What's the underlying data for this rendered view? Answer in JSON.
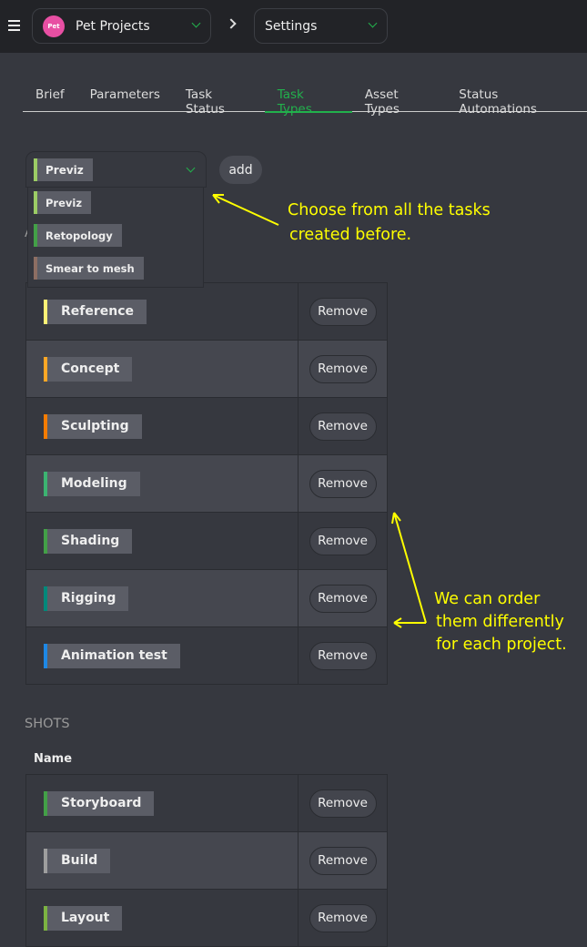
{
  "topbar": {
    "project": "Pet Projects",
    "section": "Settings",
    "logo_text": "Pet Projects"
  },
  "tabs": [
    {
      "label": "Brief"
    },
    {
      "label": "Parameters"
    },
    {
      "label": "Task Status"
    },
    {
      "label": "Task Types",
      "active": true
    },
    {
      "label": "Asset Types"
    },
    {
      "label": "Status Automations"
    }
  ],
  "selector": {
    "selected": {
      "label": "Previz",
      "color": "#9ccc65"
    },
    "add_label": "add",
    "options": [
      {
        "label": "Previz",
        "color": "#9ccc65"
      },
      {
        "label": "Retopology",
        "color": "#43a047"
      },
      {
        "label": "Smear to mesh",
        "color": "#8d6e63"
      }
    ]
  },
  "assets": {
    "heading": "A",
    "rows": [
      {
        "label": "Reference",
        "color": "#fff176"
      },
      {
        "label": "Concept",
        "color": "#ffa726"
      },
      {
        "label": "Sculpting",
        "color": "#f57c00"
      },
      {
        "label": "Modeling",
        "color": "#3cb371"
      },
      {
        "label": "Shading",
        "color": "#43a047"
      },
      {
        "label": "Rigging",
        "color": "#00897b"
      },
      {
        "label": "Animation test",
        "color": "#1e88e5"
      }
    ]
  },
  "shots": {
    "heading": "SHOTS",
    "name_header": "Name",
    "rows": [
      {
        "label": "Storyboard",
        "color": "#43a047"
      },
      {
        "label": "Build",
        "color": "#9e9e9e"
      },
      {
        "label": "Layout",
        "color": "#7cb342"
      }
    ]
  },
  "remove_label": "Remove",
  "annotations": {
    "choose": [
      "Choose from all the tasks",
      "created before."
    ],
    "order": [
      "We can order",
      "them differently",
      "for each project."
    ],
    "color": "#ffff00"
  }
}
